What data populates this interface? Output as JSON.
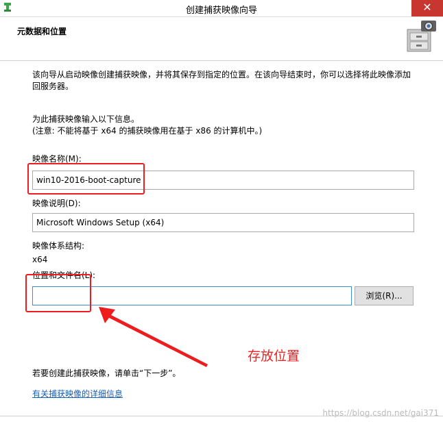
{
  "window": {
    "title": "创建捕获映像向导",
    "close_glyph": "✕"
  },
  "header": {
    "title": "元数据和位置",
    "icon": "file-cabinet-camera-icon"
  },
  "intro": {
    "line1": "该向导从启动映像创建捕获映像，并将其保存到指定的位置。在该向导结束时，你可以选择将此映像添加",
    "line2": "回服务器。"
  },
  "info": {
    "line1": "为此捕获映像输入以下信息。",
    "line2": "(注意: 不能将基于 x64 的捕获映像用在基于 x86 的计算机中。)"
  },
  "form": {
    "image_name_label": "映像名称(M):",
    "image_name_value": "win10-2016-boot-capture",
    "image_desc_label": "映像说明(D):",
    "image_desc_value": "Microsoft Windows Setup (x64)",
    "arch_label": "映像体系结构:",
    "arch_value": "x64",
    "location_label": "位置和文件名(L):",
    "location_value": "",
    "browse_label": "浏览(R)..."
  },
  "footer": {
    "instruction": "若要创建此捕获映像，请单击“下一步”。",
    "link": "有关捕获映像的详细信息"
  },
  "annotation": {
    "text": "存放位置",
    "color": "#ee2222"
  },
  "watermark": "https://blog.csdn.net/gai371"
}
